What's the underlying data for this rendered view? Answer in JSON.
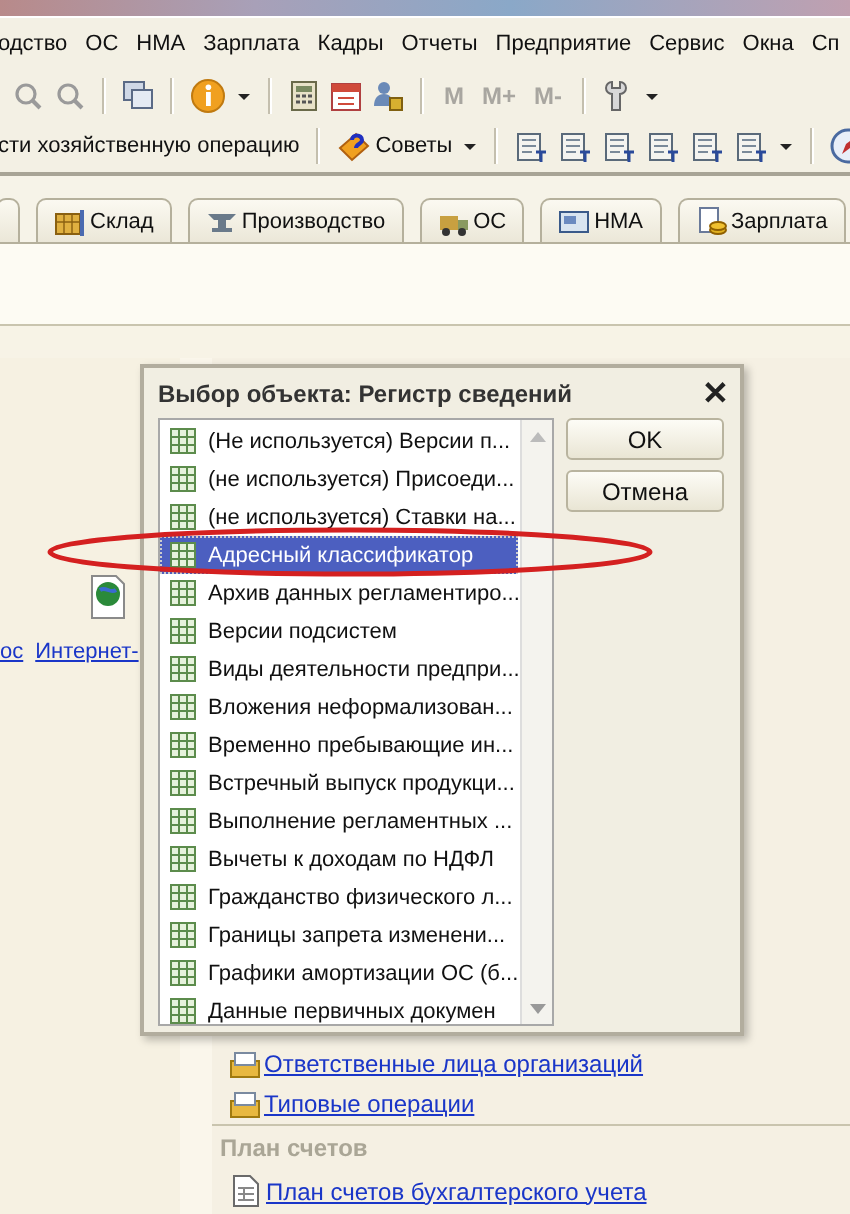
{
  "menu": [
    {
      "label": "одство"
    },
    {
      "label": "ОС"
    },
    {
      "label": "НМА"
    },
    {
      "label": "Зарплата"
    },
    {
      "label": "Кадры"
    },
    {
      "label": "Отчеты"
    },
    {
      "label": "Предприятие"
    },
    {
      "label": "Сервис"
    },
    {
      "label": "Окна"
    },
    {
      "label": "Сп"
    }
  ],
  "toolbar": {
    "memory_buttons": [
      {
        "label": "M",
        "disabled": true
      },
      {
        "label": "M+",
        "disabled": true
      },
      {
        "label": "M-",
        "disabled": true
      }
    ]
  },
  "operations_toolbar": {
    "operation_button": "сти хозяйственную операцию",
    "tips_button": "Советы"
  },
  "tabs": [
    {
      "label": "Склад",
      "selected": false
    },
    {
      "label": "Производство",
      "selected": false
    },
    {
      "label": "ОС",
      "selected": false
    },
    {
      "label": "НМА",
      "selected": false
    },
    {
      "label": "Зарплата",
      "selected": false
    }
  ],
  "left_panel": {
    "links": [
      "ос",
      "Интернет-"
    ]
  },
  "actions": {
    "links": [
      "Ответственные лица организаций",
      "Типовые операции"
    ]
  },
  "section": {
    "title": "План счетов",
    "links": [
      "План счетов бухгалтерского учета"
    ]
  },
  "dialog": {
    "title": "Выбор объекта: Регистр сведений",
    "close_button": "✕",
    "buttons": [
      "OK",
      "Отмена"
    ],
    "items": [
      {
        "label": "(Не используется) Версии п...",
        "selected": false
      },
      {
        "label": "(не используется) Присоеди...",
        "selected": false
      },
      {
        "label": "(не используется) Ставки на...",
        "selected": false
      },
      {
        "label": "Адресный классификатор",
        "selected": true
      },
      {
        "label": "Архив данных регламентиро...",
        "selected": false
      },
      {
        "label": "Версии подсистем",
        "selected": false
      },
      {
        "label": "Виды деятельности предпри...",
        "selected": false
      },
      {
        "label": "Вложения неформализован...",
        "selected": false
      },
      {
        "label": "Временно пребывающие ин...",
        "selected": false
      },
      {
        "label": "Встречный выпуск продукци...",
        "selected": false
      },
      {
        "label": "Выполнение регламентных ...",
        "selected": false
      },
      {
        "label": "Вычеты к доходам по НДФЛ",
        "selected": false
      },
      {
        "label": "Гражданство физического л...",
        "selected": false
      },
      {
        "label": "Границы запрета изменени...",
        "selected": false
      },
      {
        "label": "Графики амортизации ОС (б...",
        "selected": false
      },
      {
        "label": "Данные первичных докумен",
        "selected": false
      }
    ]
  }
}
